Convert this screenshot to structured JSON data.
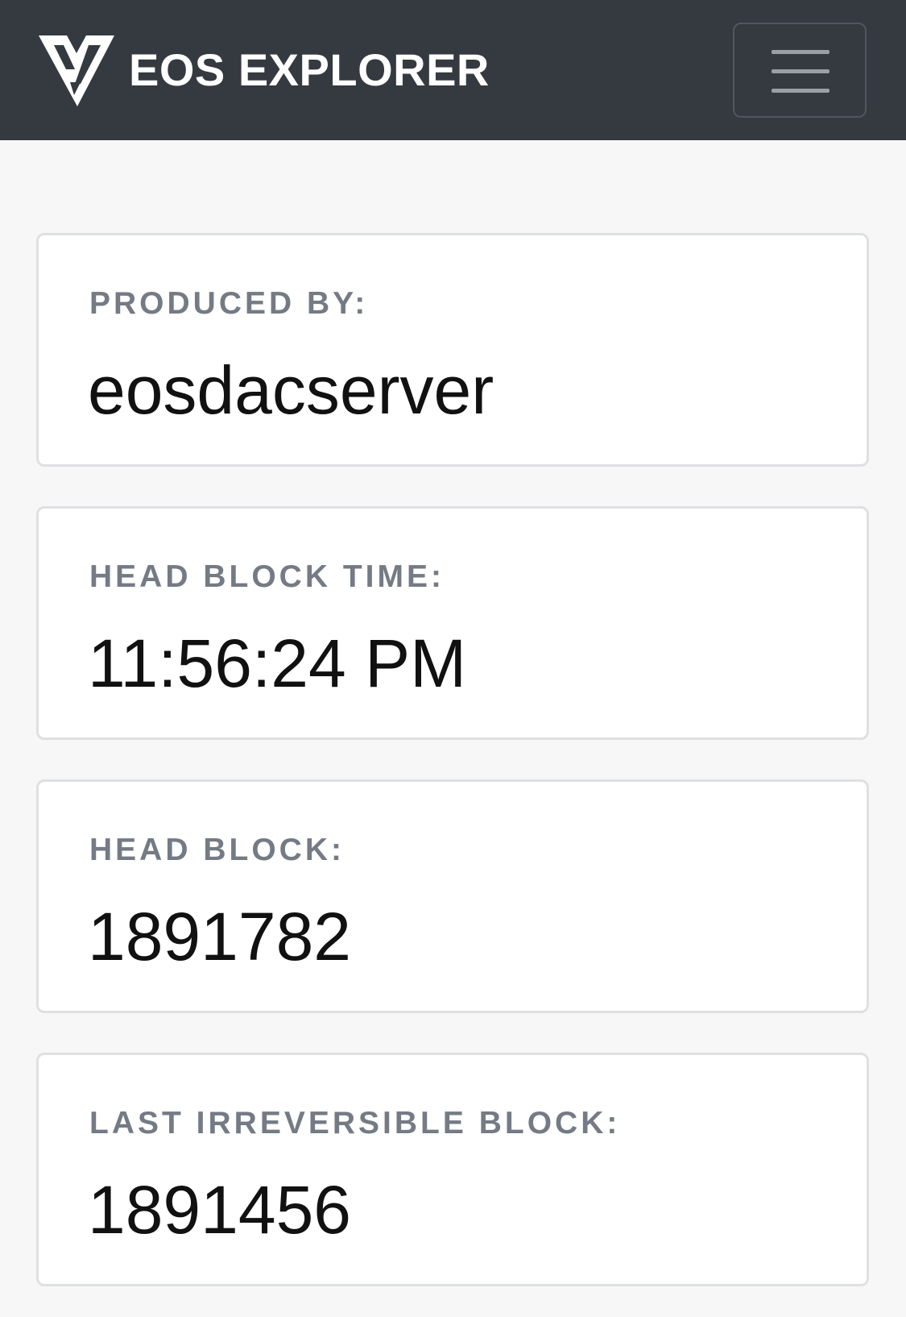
{
  "navbar": {
    "brand_name": "EOS EXPLORER",
    "logo_icon": "eos-explorer-logo-icon",
    "menu_icon": "hamburger-menu-icon",
    "background_color": "#343a40"
  },
  "stats": [
    {
      "label": "PRODUCED BY:",
      "value": "eosdacserver"
    },
    {
      "label": "HEAD BLOCK TIME:",
      "value": "11:56:24 PM"
    },
    {
      "label": "HEAD BLOCK:",
      "value": "1891782"
    },
    {
      "label": "LAST IRREVERSIBLE BLOCK:",
      "value": "1891456"
    }
  ],
  "colors": {
    "page_background": "#f7f7f7",
    "card_background": "#ffffff",
    "card_border": "#dfe0e2",
    "label_text": "#747b84",
    "value_text": "#111111"
  }
}
